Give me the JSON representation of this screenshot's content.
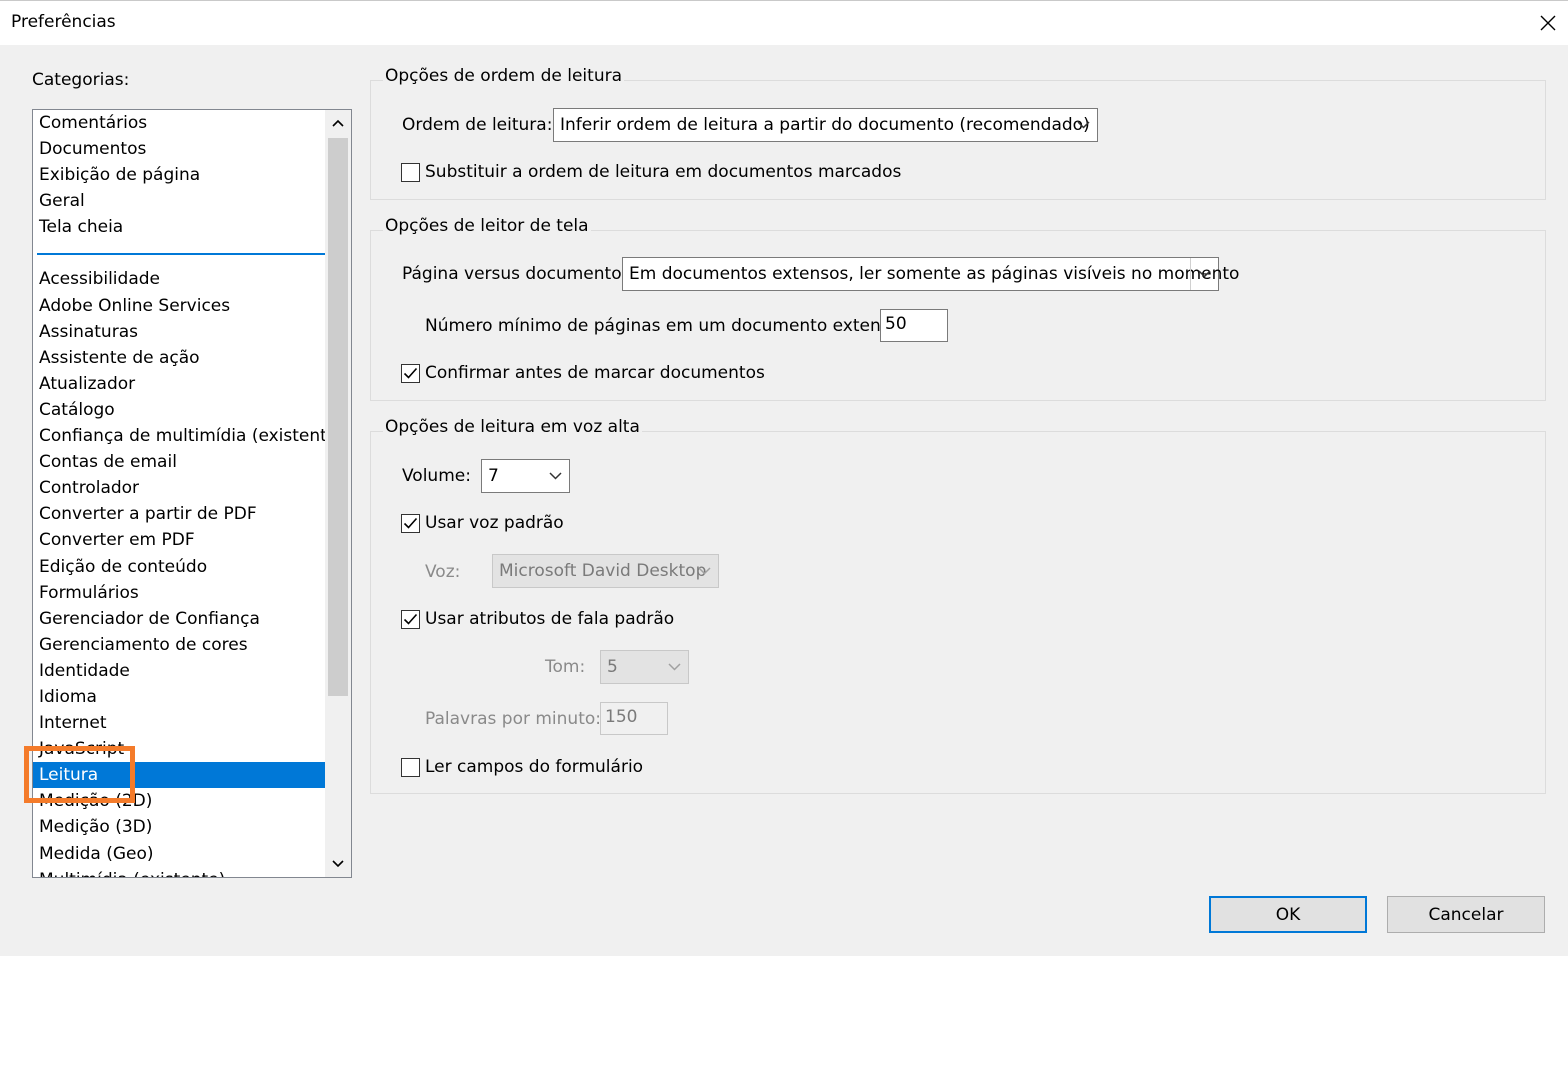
{
  "window": {
    "title": "Preferências"
  },
  "categories": {
    "label": "Categorias:",
    "top_items": [
      "Comentários",
      "Documentos",
      "Exibição de página",
      "Geral",
      "Tela cheia"
    ],
    "items": [
      "Acessibilidade",
      "Adobe Online Services",
      "Assinaturas",
      "Assistente de ação",
      "Atualizador",
      "Catálogo",
      "Confiança de multimídia (existente)",
      "Contas de email",
      "Controlador",
      "Converter a partir de PDF",
      "Converter em PDF",
      "Edição de conteúdo",
      "Formulários",
      "Gerenciador de Confiança",
      "Gerenciamento de cores",
      "Identidade",
      "Idioma",
      "Internet",
      "JavaScript",
      "Leitura",
      "Medição (2D)",
      "Medição (3D)",
      "Medida (Geo)",
      "Multimídia (existente)"
    ],
    "selected": "Leitura",
    "selected_color": "#0078d7",
    "highlight_color": "#f47b2a"
  },
  "reading_order": {
    "legend": "Opções de ordem de leitura",
    "order_label": "Ordem de leitura:",
    "order_value": "Inferir ordem de leitura a partir do documento (recomendado)",
    "override_label": "Substituir a ordem de leitura em documentos marcados",
    "override_checked": false
  },
  "screen_reader": {
    "legend": "Opções de leitor de tela",
    "page_vs_doc_label": "Página versus documento:",
    "page_vs_doc_value": "Em documentos extensos, ler somente as páginas visíveis no momento",
    "min_pages_label": "Número mínimo de páginas em um documento extenso:",
    "min_pages_value": "50",
    "confirm_label": "Confirmar antes de marcar documentos",
    "confirm_checked": true
  },
  "read_aloud": {
    "legend": "Opções de leitura em voz alta",
    "volume_label": "Volume:",
    "volume_value": "7",
    "default_voice_label": "Usar voz padrão",
    "default_voice_checked": true,
    "voice_label": "Voz:",
    "voice_value": "Microsoft David Desktop",
    "default_speech_label": "Usar atributos de fala padrão",
    "default_speech_checked": true,
    "pitch_label": "Tom:",
    "pitch_value": "5",
    "wpm_label": "Palavras por minuto:",
    "wpm_value": "150",
    "form_fields_label": "Ler campos do formulário",
    "form_fields_checked": false
  },
  "buttons": {
    "ok": "OK",
    "cancel": "Cancelar"
  },
  "icons": {
    "close": "close-icon",
    "scroll_up": "chevron-up-icon",
    "scroll_down": "chevron-down-icon",
    "dropdown": "chevron-down-icon",
    "check": "checkmark-icon"
  }
}
